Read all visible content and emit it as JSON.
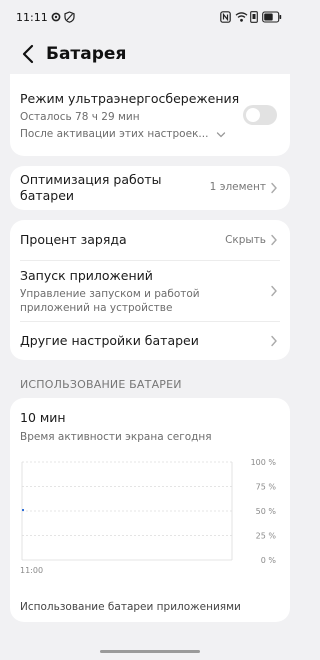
{
  "status_bar": {
    "time": "11:11"
  },
  "header": {
    "title": "Батарея"
  },
  "ultra_saving": {
    "title": "Режим ультраэнергосбережения",
    "remaining": "Осталось 78 ч 29 мин",
    "description": "После активации этих настроек...",
    "toggle_on": false
  },
  "optimization": {
    "title": "Оптимизация работы батареи",
    "value": "1 элемент"
  },
  "settings": {
    "items": [
      {
        "title": "Процент заряда",
        "value": "Скрыть"
      },
      {
        "title": "Запуск приложений",
        "subtitle": "Управление запуском и работой приложений на устройстве"
      },
      {
        "title": "Другие настройки батареи"
      }
    ]
  },
  "usage": {
    "section_title": "ИСПОЛЬЗОВАНИЕ БАТАРЕИ",
    "duration": "10 мин",
    "duration_caption": "Время активности экрана сегодня",
    "footer": "Использование батареи приложениями"
  },
  "chart_data": {
    "type": "bar",
    "x_tick_labels": [
      "11:00"
    ],
    "y_tick_labels": [
      "100 %",
      "75 %",
      "50 %",
      "25 %",
      "0 %"
    ],
    "ylim": [
      0,
      100
    ],
    "grid": true,
    "series": [
      {
        "values": [
          51
        ]
      }
    ],
    "colors": {
      "bar": "#2f6fd8",
      "grid": "#dcdcdc"
    }
  }
}
